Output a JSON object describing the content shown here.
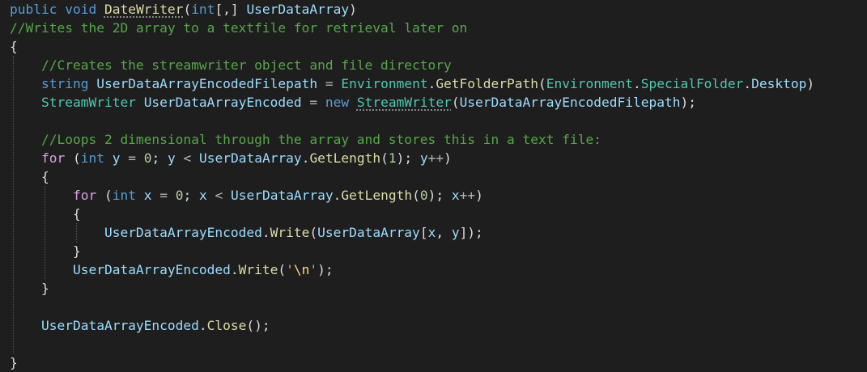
{
  "editor": {
    "colors": {
      "background": "#1e1e1e",
      "keyword": "#569cd6",
      "control": "#d8a0df",
      "method": "#dcdcaa",
      "type": "#4ec9b0",
      "variable": "#9cdcfe",
      "comment": "#57a64a",
      "number": "#b5cea8",
      "string": "#d69d85",
      "escape": "#ffd68f",
      "punctuation": "#dcdcdc"
    },
    "lines": [
      [
        {
          "t": "public",
          "c": "keyword"
        },
        {
          "t": " ",
          "c": "plain"
        },
        {
          "t": "void",
          "c": "keyword"
        },
        {
          "t": " ",
          "c": "plain"
        },
        {
          "t": "DateWriter",
          "c": "method",
          "u": true
        },
        {
          "t": "(",
          "c": "punct"
        },
        {
          "t": "int",
          "c": "keyword"
        },
        {
          "t": "[,]",
          "c": "punct"
        },
        {
          "t": " ",
          "c": "plain"
        },
        {
          "t": "UserDataArray",
          "c": "var"
        },
        {
          "t": ")",
          "c": "punct"
        }
      ],
      [
        {
          "t": "//Writes the 2D array to a textfile for retrieval later on",
          "c": "comment"
        }
      ],
      [
        {
          "t": "{",
          "c": "punct"
        }
      ],
      [
        {
          "t": "    ",
          "c": "plain"
        },
        {
          "t": "//Creates the streamwriter object and file directory",
          "c": "comment"
        }
      ],
      [
        {
          "t": "    ",
          "c": "plain"
        },
        {
          "t": "string",
          "c": "keyword"
        },
        {
          "t": " ",
          "c": "plain"
        },
        {
          "t": "UserDataArrayEncodedFilepath",
          "c": "var"
        },
        {
          "t": " = ",
          "c": "op"
        },
        {
          "t": "Environment",
          "c": "type"
        },
        {
          "t": ".",
          "c": "punct"
        },
        {
          "t": "GetFolderPath",
          "c": "method"
        },
        {
          "t": "(",
          "c": "punct"
        },
        {
          "t": "Environment",
          "c": "type"
        },
        {
          "t": ".",
          "c": "punct"
        },
        {
          "t": "SpecialFolder",
          "c": "type"
        },
        {
          "t": ".",
          "c": "punct"
        },
        {
          "t": "Desktop",
          "c": "var"
        },
        {
          "t": ")",
          "c": "punct"
        }
      ],
      [
        {
          "t": "    ",
          "c": "plain"
        },
        {
          "t": "StreamWriter",
          "c": "type"
        },
        {
          "t": " ",
          "c": "plain"
        },
        {
          "t": "UserDataArrayEncoded",
          "c": "var"
        },
        {
          "t": " = ",
          "c": "op"
        },
        {
          "t": "new",
          "c": "keyword"
        },
        {
          "t": " ",
          "c": "plain"
        },
        {
          "t": "StreamWriter",
          "c": "type",
          "u": true
        },
        {
          "t": "(",
          "c": "punct"
        },
        {
          "t": "UserDataArrayEncodedFilepath",
          "c": "var"
        },
        {
          "t": ");",
          "c": "punct"
        }
      ],
      [],
      [
        {
          "t": "    ",
          "c": "plain"
        },
        {
          "t": "//Loops 2 dimensional through the array and stores this in a text file:",
          "c": "comment"
        }
      ],
      [
        {
          "t": "    ",
          "c": "plain"
        },
        {
          "t": "for",
          "c": "control"
        },
        {
          "t": " (",
          "c": "punct"
        },
        {
          "t": "int",
          "c": "keyword"
        },
        {
          "t": " ",
          "c": "plain"
        },
        {
          "t": "y",
          "c": "var"
        },
        {
          "t": " = ",
          "c": "op"
        },
        {
          "t": "0",
          "c": "number"
        },
        {
          "t": "; ",
          "c": "punct"
        },
        {
          "t": "y",
          "c": "var"
        },
        {
          "t": " < ",
          "c": "op"
        },
        {
          "t": "UserDataArray",
          "c": "var"
        },
        {
          "t": ".",
          "c": "punct"
        },
        {
          "t": "GetLength",
          "c": "method"
        },
        {
          "t": "(",
          "c": "punct"
        },
        {
          "t": "1",
          "c": "number"
        },
        {
          "t": "); ",
          "c": "punct"
        },
        {
          "t": "y",
          "c": "var"
        },
        {
          "t": "++",
          "c": "op"
        },
        {
          "t": ")",
          "c": "punct"
        }
      ],
      [
        {
          "t": "    ",
          "c": "plain"
        },
        {
          "t": "{",
          "c": "punct"
        }
      ],
      [
        {
          "t": "        ",
          "c": "plain"
        },
        {
          "t": "for",
          "c": "control"
        },
        {
          "t": " (",
          "c": "punct"
        },
        {
          "t": "int",
          "c": "keyword"
        },
        {
          "t": " ",
          "c": "plain"
        },
        {
          "t": "x",
          "c": "var"
        },
        {
          "t": " = ",
          "c": "op"
        },
        {
          "t": "0",
          "c": "number"
        },
        {
          "t": "; ",
          "c": "punct"
        },
        {
          "t": "x",
          "c": "var"
        },
        {
          "t": " < ",
          "c": "op"
        },
        {
          "t": "UserDataArray",
          "c": "var"
        },
        {
          "t": ".",
          "c": "punct"
        },
        {
          "t": "GetLength",
          "c": "method"
        },
        {
          "t": "(",
          "c": "punct"
        },
        {
          "t": "0",
          "c": "number"
        },
        {
          "t": "); ",
          "c": "punct"
        },
        {
          "t": "x",
          "c": "var"
        },
        {
          "t": "++",
          "c": "op"
        },
        {
          "t": ")",
          "c": "punct"
        }
      ],
      [
        {
          "t": "        ",
          "c": "plain"
        },
        {
          "t": "{",
          "c": "punct"
        }
      ],
      [
        {
          "t": "            ",
          "c": "plain"
        },
        {
          "t": "UserDataArrayEncoded",
          "c": "var"
        },
        {
          "t": ".",
          "c": "punct"
        },
        {
          "t": "Write",
          "c": "method"
        },
        {
          "t": "(",
          "c": "punct"
        },
        {
          "t": "UserDataArray",
          "c": "var"
        },
        {
          "t": "[",
          "c": "punct"
        },
        {
          "t": "x",
          "c": "var"
        },
        {
          "t": ", ",
          "c": "punct"
        },
        {
          "t": "y",
          "c": "var"
        },
        {
          "t": "]);",
          "c": "punct"
        }
      ],
      [
        {
          "t": "        ",
          "c": "plain"
        },
        {
          "t": "}",
          "c": "punct"
        }
      ],
      [
        {
          "t": "        ",
          "c": "plain"
        },
        {
          "t": "UserDataArrayEncoded",
          "c": "var"
        },
        {
          "t": ".",
          "c": "punct"
        },
        {
          "t": "Write",
          "c": "method"
        },
        {
          "t": "(",
          "c": "punct"
        },
        {
          "t": "'",
          "c": "string"
        },
        {
          "t": "\\n",
          "c": "escape"
        },
        {
          "t": "'",
          "c": "string"
        },
        {
          "t": ");",
          "c": "punct"
        }
      ],
      [
        {
          "t": "    ",
          "c": "plain"
        },
        {
          "t": "}",
          "c": "punct"
        }
      ],
      [],
      [
        {
          "t": "    ",
          "c": "plain"
        },
        {
          "t": "UserDataArrayEncoded",
          "c": "var"
        },
        {
          "t": ".",
          "c": "punct"
        },
        {
          "t": "Close",
          "c": "method"
        },
        {
          "t": "();",
          "c": "punct"
        }
      ],
      [],
      [
        {
          "t": "}",
          "c": "punct"
        }
      ]
    ]
  }
}
